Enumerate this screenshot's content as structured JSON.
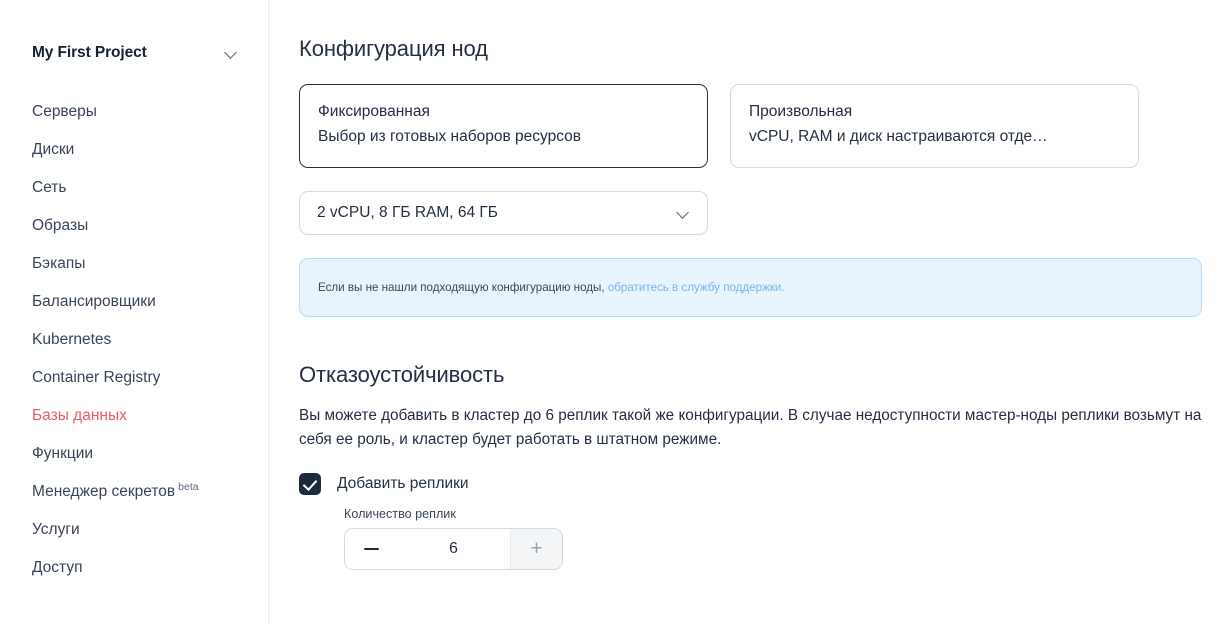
{
  "sidebar": {
    "project": {
      "name": "My First Project",
      "chevron_icon": "chevron-down-icon"
    },
    "items": [
      {
        "label": "Серверы",
        "active": false
      },
      {
        "label": "Диски",
        "active": false
      },
      {
        "label": "Сеть",
        "active": false
      },
      {
        "label": "Образы",
        "active": false
      },
      {
        "label": "Бэкапы",
        "active": false
      },
      {
        "label": "Балансировщики",
        "active": false
      },
      {
        "label": "Kubernetes",
        "active": false
      },
      {
        "label": "Container Registry",
        "active": false
      },
      {
        "label": "Базы данных",
        "active": true
      },
      {
        "label": "Функции",
        "active": false
      },
      {
        "label": "Менеджер секретов",
        "badge": "beta",
        "active": false
      },
      {
        "label": "Услуги",
        "active": false
      },
      {
        "label": "Доступ",
        "active": false
      }
    ]
  },
  "main": {
    "node_config": {
      "title": "Конфигурация нод",
      "cards": [
        {
          "title": "Фиксированная",
          "subtitle": "Выбор из готовых наборов ресурсов",
          "selected": true
        },
        {
          "title": "Произвольная",
          "subtitle": "vCPU, RAM и диск настраиваются отде…",
          "selected": false
        }
      ],
      "flavor_select": {
        "value": "2 vCPU, 8 ГБ RAM, 64 ГБ",
        "chevron_icon": "chevron-down-icon"
      },
      "info_banner": {
        "text": "Если вы не нашли подходящую конфигурацию ноды,",
        "link": "обратитесь в службу поддержки."
      }
    },
    "fault_tolerance": {
      "title": "Отказоустойчивость",
      "description": "Вы можете добавить в кластер до 6 реплик такой же конфигурации. В случае недоступности мастер-ноды реплики возьмут на себя ее роль, и кластер будет работать в штатном режиме.",
      "checkbox": {
        "label": "Добавить реплики",
        "checked": true,
        "icon": "check-icon"
      },
      "stepper": {
        "label": "Количество реплик",
        "value": "6",
        "decrement_icon": "minus-icon",
        "increment_icon": "plus-icon",
        "increment_disabled": true
      }
    }
  },
  "colors": {
    "accent_red": "#ec5a60",
    "selected_border": "#28313f",
    "banner_bg": "#e7f3fd",
    "banner_border": "#bcdcf5",
    "link_blue": "#7ab4ee",
    "checkbox_fill": "#1d2a3c"
  }
}
